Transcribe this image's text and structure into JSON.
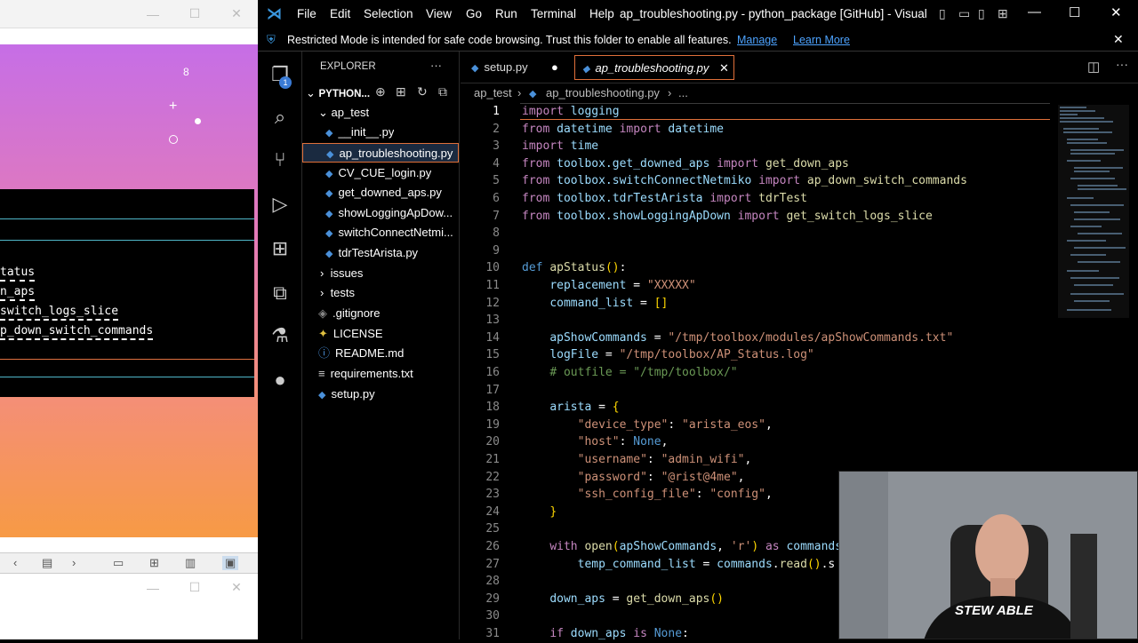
{
  "left_window": {
    "controls": {
      "minimize": "—",
      "maximize": "☐",
      "close": "✕"
    },
    "canvas_number": "8",
    "terminal_lines": [
      "tatus",
      "n_aps",
      "switch_logs_slice",
      "p_down_switch_commands"
    ],
    "toolbar_icons": [
      "chevron-left-icon",
      "list-icon",
      "chevron-right-icon",
      "window-icon",
      "grid-icon",
      "book-icon",
      "tray-icon"
    ]
  },
  "vscode": {
    "menu": [
      "File",
      "Edit",
      "Selection",
      "View",
      "Go",
      "Run",
      "Terminal",
      "Help"
    ],
    "title": "ap_troubleshooting.py - python_package [GitHub] - Visual Stu...",
    "notice": {
      "text": "Restricted Mode is intended for safe code browsing. Trust this folder to enable all features.",
      "manage": "Manage",
      "learn_more": "Learn More"
    },
    "explorer": {
      "title": "EXPLORER",
      "more": "···",
      "repo": "PYTHON...",
      "badge": "1",
      "folder_ap_test": "ap_test",
      "files_ap_test": [
        "__init__.py",
        "ap_troubleshooting.py",
        "CV_CUE_login.py",
        "get_downed_aps.py",
        "showLoggingApDow...",
        "switchConnectNetmi...",
        "tdrTestArista.py"
      ],
      "folders": [
        "issues",
        "tests"
      ],
      "root_files": [
        ".gitignore",
        "LICENSE",
        "README.md",
        "requirements.txt",
        "setup.py"
      ]
    },
    "tabs": [
      {
        "label": "setup.py",
        "modified": "●"
      },
      {
        "label": "ap_troubleshooting.py",
        "close": "✕"
      }
    ],
    "breadcrumb": [
      "ap_test",
      "ap_troubleshooting.py",
      "..."
    ],
    "code_lines": [
      {
        "n": "1",
        "html": "<span class='kw'>import</span> <span class='va'>logging</span>"
      },
      {
        "n": "2",
        "html": "<span class='kw'>from</span> <span class='va'>datetime</span> <span class='kw'>import</span> <span class='va'>datetime</span>"
      },
      {
        "n": "3",
        "html": "<span class='kw'>import</span> <span class='va'>time</span>"
      },
      {
        "n": "4",
        "html": "<span class='kw'>from</span> <span class='va'>toolbox.get_downed_aps</span> <span class='kw'>import</span> <span class='fn'>get_down_aps</span>"
      },
      {
        "n": "5",
        "html": "<span class='kw'>from</span> <span class='va'>toolbox.switchConnectNetmiko</span> <span class='kw'>import</span> <span class='fn'>ap_down_switch_commands</span>"
      },
      {
        "n": "6",
        "html": "<span class='kw'>from</span> <span class='va'>toolbox.tdrTestArista</span> <span class='kw'>import</span> <span class='fn'>tdrTest</span>"
      },
      {
        "n": "7",
        "html": "<span class='kw'>from</span> <span class='va'>toolbox.showLoggingApDown</span> <span class='kw'>import</span> <span class='fn'>get_switch_logs_slice</span>"
      },
      {
        "n": "8",
        "html": ""
      },
      {
        "n": "9",
        "html": ""
      },
      {
        "n": "10",
        "html": "<span class='bl'>def</span> <span class='fn'>apStatus</span><span class='br'>()</span>:"
      },
      {
        "n": "11",
        "html": "    <span class='va'>replacement</span> = <span class='st'>\"XXXXX\"</span>"
      },
      {
        "n": "12",
        "html": "    <span class='va'>command_list</span> = <span class='br'>[]</span>"
      },
      {
        "n": "13",
        "html": ""
      },
      {
        "n": "14",
        "html": "    <span class='va'>apShowCommands</span> = <span class='st'>\"/tmp/toolbox/modules/apShowCommands.txt\"</span>"
      },
      {
        "n": "15",
        "html": "    <span class='va'>logFile</span> = <span class='st'>\"/tmp/toolbox/AP_Status.log\"</span>"
      },
      {
        "n": "16",
        "html": "    <span class='co'># outfile = \"/tmp/toolbox/\"</span>"
      },
      {
        "n": "17",
        "html": ""
      },
      {
        "n": "18",
        "html": "    <span class='va'>arista</span> = <span class='br'>{</span>"
      },
      {
        "n": "19",
        "html": "        <span class='st'>\"device_type\"</span>: <span class='st'>\"arista_eos\"</span>,"
      },
      {
        "n": "20",
        "html": "        <span class='st'>\"host\"</span>: <span class='bl'>None</span>,"
      },
      {
        "n": "21",
        "html": "        <span class='st'>\"username\"</span>: <span class='st'>\"admin_wifi\"</span>,"
      },
      {
        "n": "22",
        "html": "        <span class='st'>\"password\"</span>: <span class='st'>\"@rist@4me\"</span>,"
      },
      {
        "n": "23",
        "html": "        <span class='st'>\"ssh_config_file\"</span>: <span class='st'>\"config\"</span>,"
      },
      {
        "n": "24",
        "html": "    <span class='br'>}</span>"
      },
      {
        "n": "25",
        "html": ""
      },
      {
        "n": "26",
        "html": "    <span class='kw'>with</span> <span class='fn'>open</span><span class='br'>(</span><span class='va'>apShowCommands</span>, <span class='st'>'r'</span><span class='br'>)</span> <span class='kw'>as</span> <span class='va'>commands</span>"
      },
      {
        "n": "27",
        "html": "        <span class='va'>temp_command_list</span> = <span class='va'>commands</span>.<span class='fn'>read</span><span class='br'>()</span>.s"
      },
      {
        "n": "28",
        "html": ""
      },
      {
        "n": "29",
        "html": "    <span class='va'>down_aps</span> = <span class='fn'>get_down_aps</span><span class='br'>()</span>"
      },
      {
        "n": "30",
        "html": ""
      },
      {
        "n": "31",
        "html": "    <span class='kw'>if</span> <span class='va'>down_aps</span> <span class='kw'>is</span> <span class='bl'>None</span>:"
      }
    ],
    "webcam_shirt_text": "STEW ABLE"
  },
  "colors": {
    "accent": "#4a90d9",
    "active_tab_border": "#e0703a",
    "link": "#4da3ff"
  }
}
